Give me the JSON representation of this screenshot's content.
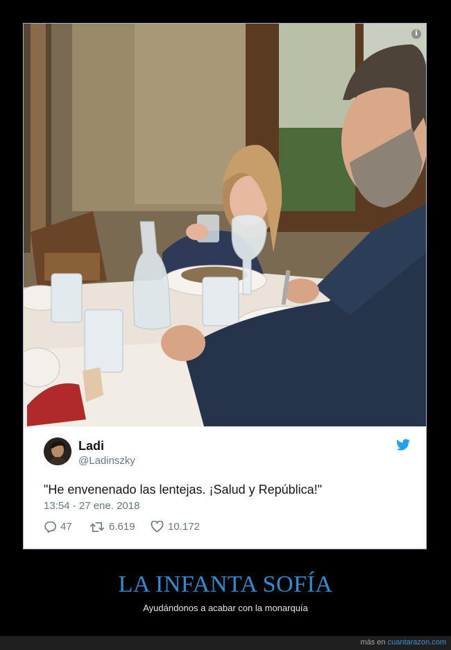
{
  "tweet": {
    "name": "Ladi",
    "handle": "@Ladinszky",
    "text": "\"He envenenado las lentejas. ¡Salud y República!\"",
    "timestamp": "13:54 - 27 ene. 2018",
    "replies": "47",
    "retweets": "6.619",
    "likes": "10.172",
    "icons": [
      "reply-icon",
      "retweet-icon",
      "like-icon",
      "twitter-bird-icon"
    ],
    "accent": "#1da1f2"
  },
  "photo": {
    "info_glyph": "i"
  },
  "caption": {
    "title": "LA INFANTA SOFÍA",
    "subtitle": "Ayudándonos a acabar con la monarquía",
    "title_color": "#2b8fd8"
  },
  "footer": {
    "prefix": "más en",
    "site": "cuantarazon.com"
  }
}
